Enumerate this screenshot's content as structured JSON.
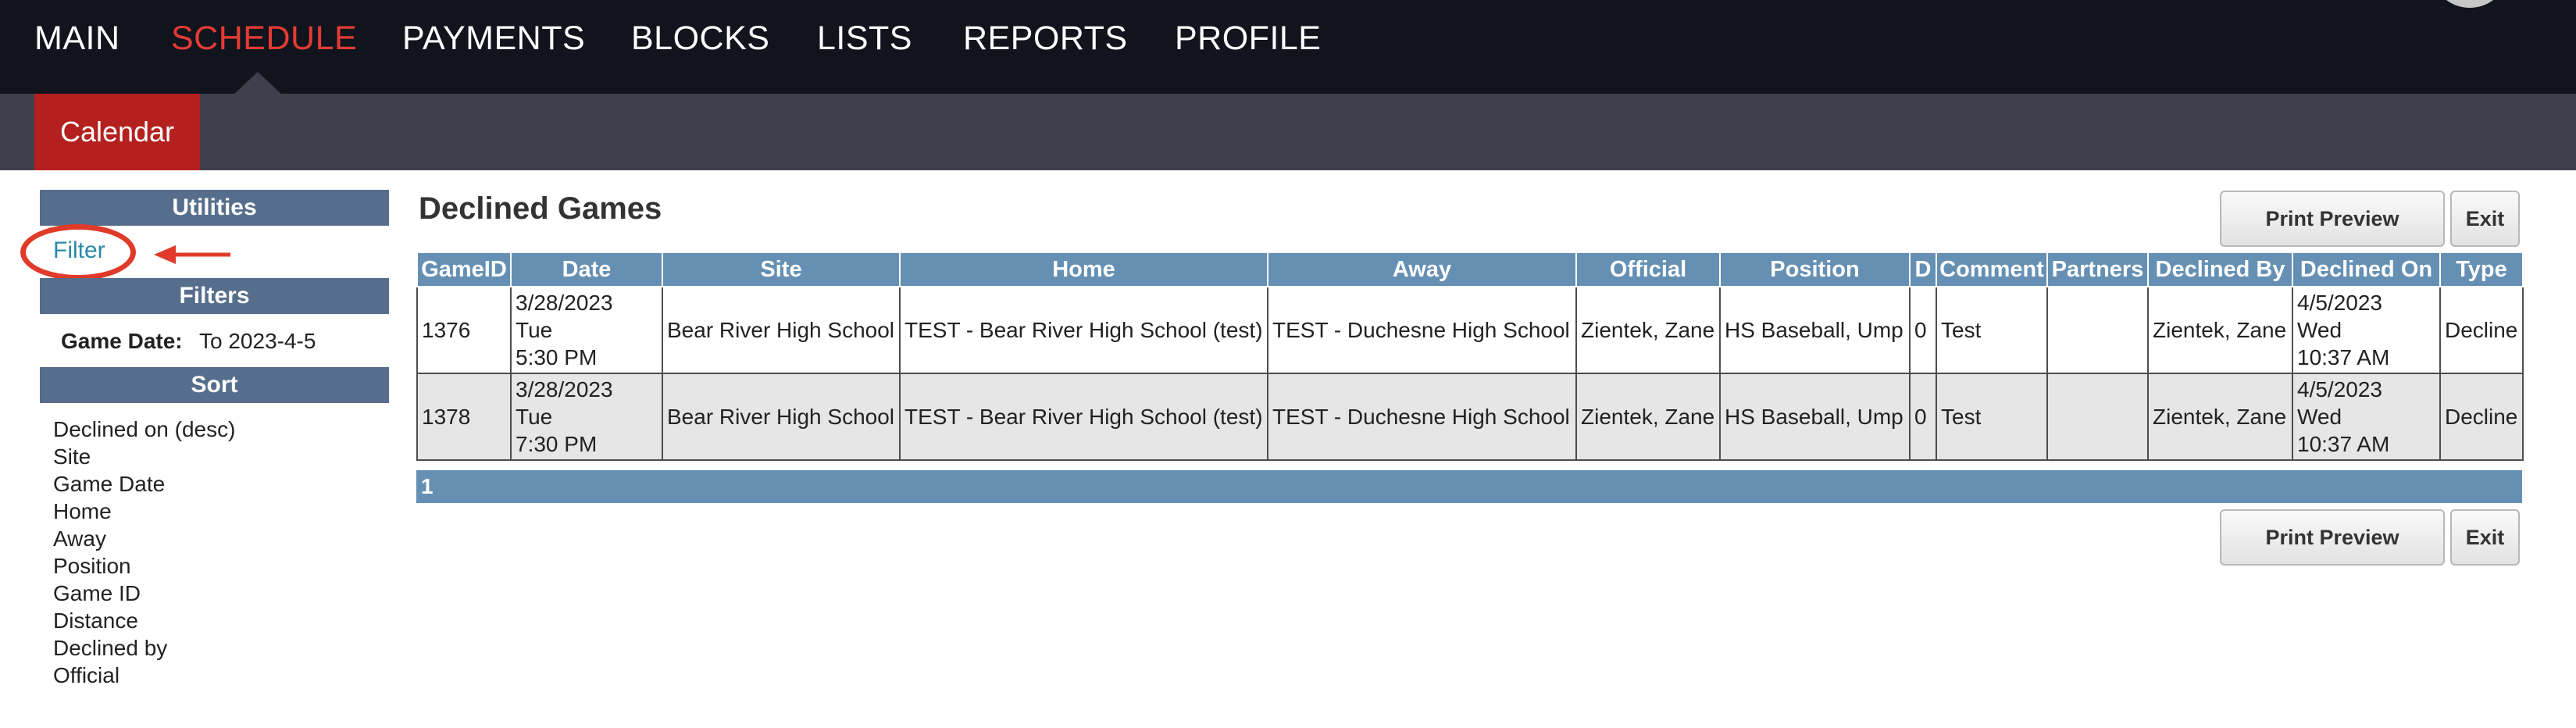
{
  "nav": {
    "items": [
      "MAIN",
      "SCHEDULE",
      "PAYMENTS",
      "BLOCKS",
      "LISTS",
      "REPORTS",
      "PROFILE"
    ],
    "active": "SCHEDULE"
  },
  "subnav": {
    "calendar_label": "Calendar"
  },
  "sidebar": {
    "utilities_header": "Utilities",
    "filter_link": "Filter",
    "filters_header": "Filters",
    "filter_label": "Game Date:",
    "filter_value": "To 2023-4-5",
    "sort_header": "Sort",
    "sort_items": [
      "Declined on (desc)",
      "Site",
      "Game Date",
      "Home",
      "Away",
      "Position",
      "Game ID",
      "Distance",
      "Declined by",
      "Official"
    ]
  },
  "main": {
    "title": "Declined Games",
    "print_preview_label": "Print Preview",
    "exit_label": "Exit",
    "columns": [
      "GameID",
      "Date",
      "Site",
      "Home",
      "Away",
      "Official",
      "Position",
      "D",
      "Comment",
      "Partners",
      "Declined By",
      "Declined On",
      "Type"
    ],
    "rows": [
      {
        "game_id": "1376",
        "date": [
          "3/28/2023",
          "Tue",
          "5:30 PM"
        ],
        "site": "Bear River High School",
        "home": "TEST - Bear River High School (test)",
        "away": "TEST - Duchesne High School",
        "official": "Zientek, Zane",
        "position": "HS Baseball, Ump",
        "d": "0",
        "comment": "Test",
        "partners": "",
        "declined_by": "Zientek, Zane",
        "declined_on": [
          "4/5/2023",
          "Wed",
          "10:37 AM"
        ],
        "type": "Decline"
      },
      {
        "game_id": "1378",
        "date": [
          "3/28/2023",
          "Tue",
          "7:30 PM"
        ],
        "site": "Bear River High School",
        "home": "TEST - Bear River High School (test)",
        "away": "TEST - Duchesne High School",
        "official": "Zientek, Zane",
        "position": "HS Baseball, Ump",
        "d": "0",
        "comment": "Test",
        "partners": "",
        "declined_by": "Zientek, Zane",
        "declined_on": [
          "4/5/2023",
          "Wed",
          "10:37 AM"
        ],
        "type": "Decline"
      }
    ],
    "pager": "1"
  },
  "colors": {
    "nav_bg": "#11131d",
    "nav_active": "#e23c34",
    "subnav_bg": "#3f404b",
    "calendar_tab": "#b4201e",
    "sidebar_header": "#566e8c",
    "table_header": "#6590b4",
    "annotation_red": "#e03b2a",
    "filter_link": "#2a89a8"
  },
  "icons": {
    "annotation_arrow": "left-arrow-icon",
    "annotation_circle": "highlight-circle"
  }
}
